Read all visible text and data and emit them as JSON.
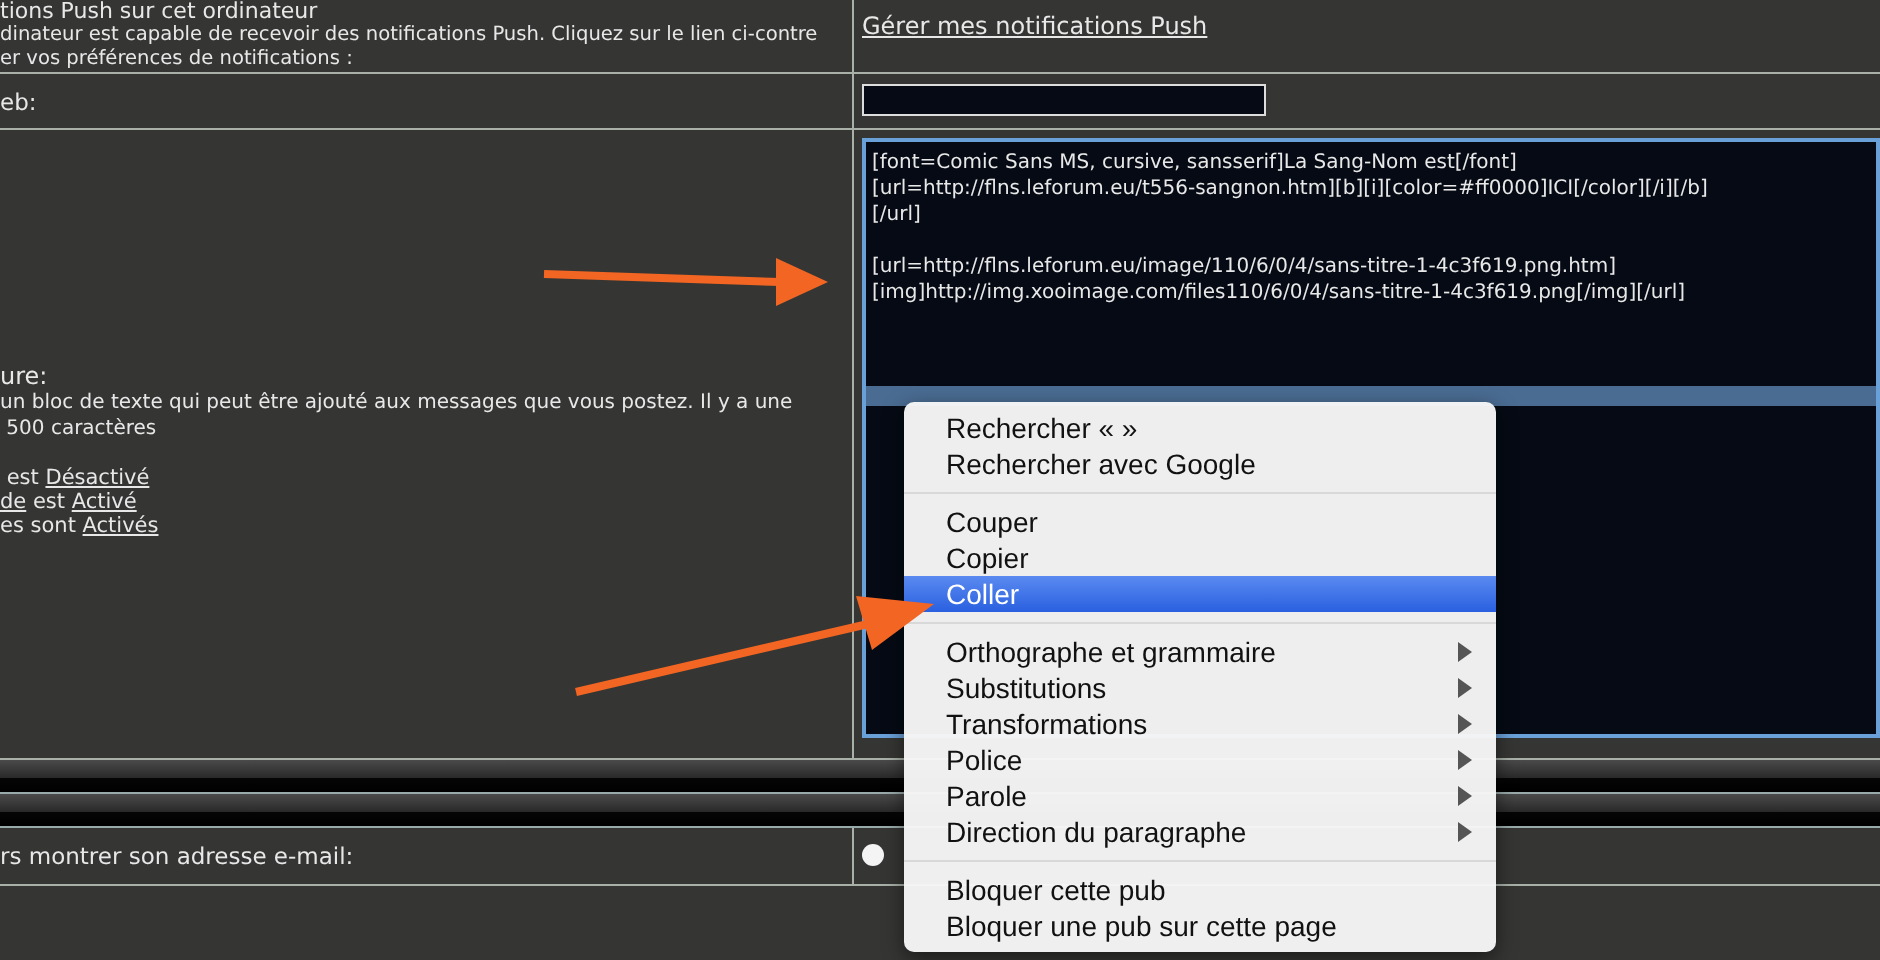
{
  "push_row": {
    "title": "tions Push sur cet ordinateur",
    "description": "dinateur est capable de recevoir des notifications Push. Cliquez sur le lien ci-contre\ner vos préférences de notifications :",
    "link": "Gérer mes notifications Push"
  },
  "website_row": {
    "label": "eb:"
  },
  "signature_row": {
    "title": "ure:",
    "description": "un bloc de texte qui peut être ajouté aux messages que vous postez. Il y a une\n 500 caractères",
    "settings": [
      {
        "text": " est ",
        "link": "Désactivé"
      },
      {
        "prefix": "de",
        "text": " est ",
        "link": "Activé"
      },
      {
        "text": "es sont ",
        "link": "Activés"
      }
    ],
    "editor": {
      "paragraphs": [
        {
          "lines": [
            "[font=Comic Sans MS, cursive, sansserif]La Sang-Nom est[/font]",
            "[url=http://flns.leforum.eu/t556-sangnon.htm][b][i][color=#ff0000]ICI[/color][/i][/b]",
            "[/url]"
          ]
        },
        {
          "lines": [
            "[url=http://flns.leforum.eu/image/110/6/0/4/sans-titre-1-4c3f619.png.htm]",
            "[img]http://img.xooimage.com/files110/6/0/4/sans-titre-1-4c3f619.png[/img][/url]"
          ]
        }
      ]
    }
  },
  "email_row": {
    "label": "rs montrer son adresse e-mail:",
    "option": {
      "selected": false
    }
  },
  "context_menu": {
    "groups": [
      [
        {
          "label": "Rechercher «  »",
          "submenu": false,
          "selected": false
        },
        {
          "label": "Rechercher avec Google",
          "submenu": false,
          "selected": false
        }
      ],
      [
        {
          "label": "Couper",
          "submenu": false,
          "selected": false
        },
        {
          "label": "Copier",
          "submenu": false,
          "selected": false
        },
        {
          "label": "Coller",
          "submenu": false,
          "selected": true
        }
      ],
      [
        {
          "label": "Orthographe et grammaire",
          "submenu": true,
          "selected": false
        },
        {
          "label": "Substitutions",
          "submenu": true,
          "selected": false
        },
        {
          "label": "Transformations",
          "submenu": true,
          "selected": false
        },
        {
          "label": "Police",
          "submenu": true,
          "selected": false
        },
        {
          "label": "Parole",
          "submenu": true,
          "selected": false
        },
        {
          "label": "Direction du paragraphe",
          "submenu": true,
          "selected": false
        }
      ],
      [
        {
          "label": "Bloquer cette pub",
          "submenu": false,
          "selected": false
        },
        {
          "label": "Bloquer une pub sur cette page",
          "submenu": false,
          "selected": false
        }
      ]
    ]
  }
}
